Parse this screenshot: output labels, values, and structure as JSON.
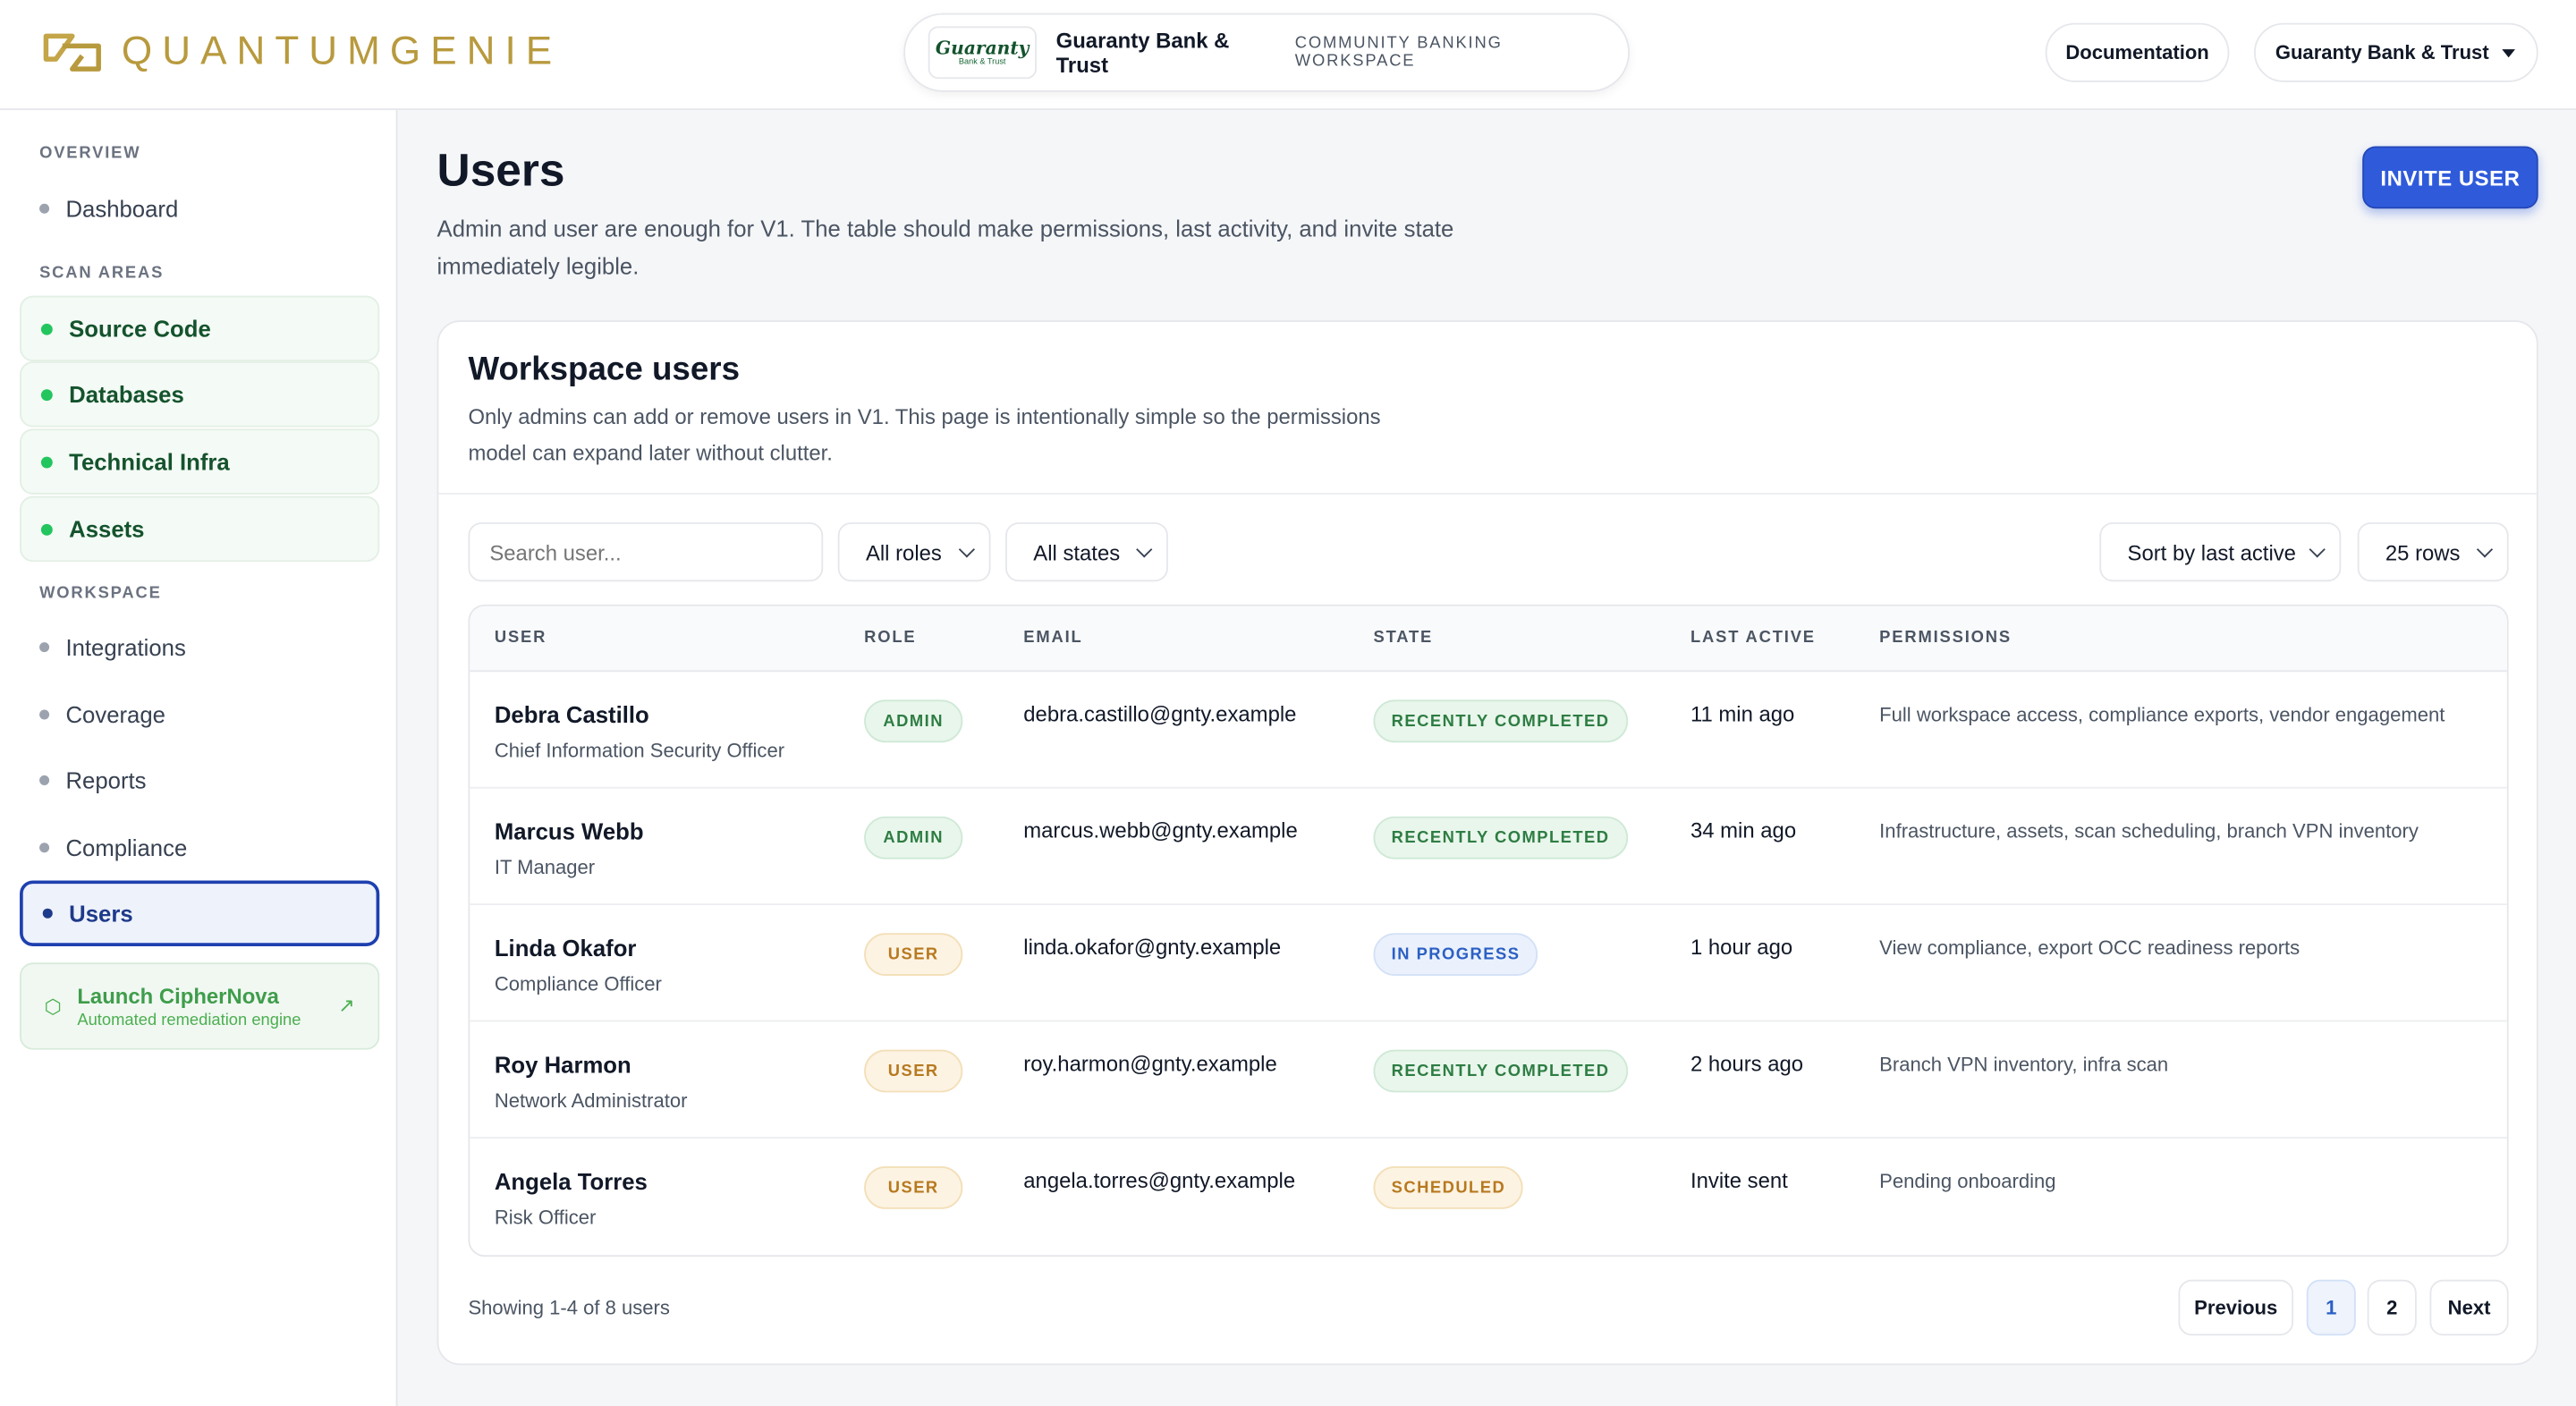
{
  "brand": {
    "name": "QUANTUMGENIE"
  },
  "tenant": {
    "logo_line1": "Guaranty",
    "logo_line2": "Bank & Trust",
    "name": "Guaranty Bank & Trust",
    "subtitle": "COMMUNITY BANKING WORKSPACE"
  },
  "header": {
    "documentation_label": "Documentation",
    "org_label": "Guaranty Bank & Trust"
  },
  "sidebar": {
    "sections": [
      {
        "title": "OVERVIEW"
      },
      {
        "title": "SCAN AREAS"
      },
      {
        "title": "WORKSPACE"
      }
    ],
    "overview_items": [
      {
        "label": "Dashboard"
      }
    ],
    "scan_items": [
      {
        "label": "Source Code"
      },
      {
        "label": "Databases"
      },
      {
        "label": "Technical Infra"
      },
      {
        "label": "Assets"
      }
    ],
    "workspace_items": [
      {
        "label": "Integrations"
      },
      {
        "label": "Coverage"
      },
      {
        "label": "Reports"
      },
      {
        "label": "Compliance"
      },
      {
        "label": "Users",
        "active": true
      }
    ],
    "launch": {
      "title": "Launch CipherNova",
      "subtitle": "Automated remediation engine"
    }
  },
  "main": {
    "title": "Users",
    "description": "Admin and user are enough for V1. The table should make permissions, last activity, and invite state immediately legible.",
    "invite_label": "INVITE USER"
  },
  "card": {
    "title": "Workspace users",
    "description": "Only admins can add or remove users in V1. This page is intentionally simple so the permissions model can expand later without clutter."
  },
  "filters": {
    "search_placeholder": "Search user...",
    "roles": "All roles",
    "states": "All states",
    "sort": "Sort by last active",
    "rows": "25 rows"
  },
  "table": {
    "headers": [
      "USER",
      "ROLE",
      "EMAIL",
      "STATE",
      "LAST ACTIVE",
      "PERMISSIONS"
    ],
    "rows": [
      {
        "name": "Debra Castillo",
        "title": "Chief Information Security Officer",
        "role": "ADMIN",
        "email": "debra.castillo@gnty.example",
        "state": "RECENTLY COMPLETED",
        "last_active": "11 min ago",
        "permissions": "Full workspace access, compliance exports, vendor engagement"
      },
      {
        "name": "Marcus Webb",
        "title": "IT Manager",
        "role": "ADMIN",
        "email": "marcus.webb@gnty.example",
        "state": "RECENTLY COMPLETED",
        "last_active": "34 min ago",
        "permissions": "Infrastructure, assets, scan scheduling, branch VPN inventory"
      },
      {
        "name": "Linda Okafor",
        "title": "Compliance Officer",
        "role": "USER",
        "email": "linda.okafor@gnty.example",
        "state": "IN PROGRESS",
        "last_active": "1 hour ago",
        "permissions": "View compliance, export OCC readiness reports"
      },
      {
        "name": "Roy Harmon",
        "title": "Network Administrator",
        "role": "USER",
        "email": "roy.harmon@gnty.example",
        "state": "RECENTLY COMPLETED",
        "last_active": "2 hours ago",
        "permissions": "Branch VPN inventory, infra scan"
      },
      {
        "name": "Angela Torres",
        "title": "Risk Officer",
        "role": "USER",
        "email": "angela.torres@gnty.example",
        "state": "SCHEDULED",
        "last_active": "Invite sent",
        "permissions": "Pending onboarding"
      }
    ]
  },
  "pagination": {
    "showing": "Showing 1-4 of 8 users",
    "previous": "Previous",
    "pages": [
      "1",
      "2"
    ],
    "next": "Next"
  },
  "colors": {
    "accent": "#2f5bdb",
    "brand_gold": "#b89a3e",
    "scan_green": "#22c55e",
    "admin_green": "#2e7d43",
    "user_amber": "#b7791f",
    "progress_blue": "#2b5fc4"
  },
  "icons": {
    "logo": "quantumgenie-logo-icon",
    "launch": "hexagon-icon",
    "launch_arrow": "arrow-up-right-icon",
    "dropdown": "chevron-down-icon"
  }
}
